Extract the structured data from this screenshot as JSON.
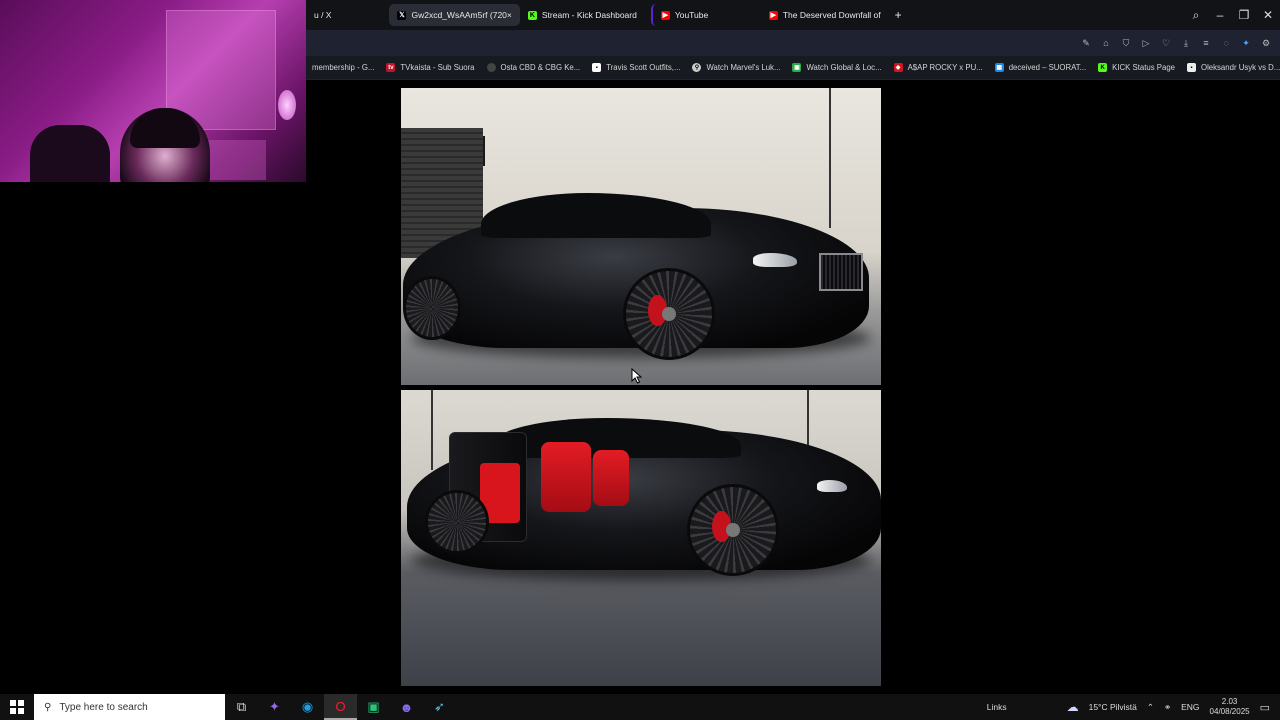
{
  "browser": {
    "tabs": [
      {
        "label": "u / X",
        "icon": "x-logo-icon",
        "active": false
      },
      {
        "label": "Gw2xcd_WsAAm5rf (720×",
        "icon": "x-logo-icon",
        "active": true
      },
      {
        "label": "Stream - Kick Dashboard",
        "icon": "kick-icon",
        "active": false
      },
      {
        "label": "YouTube",
        "icon": "youtube-icon",
        "active": false
      },
      {
        "label": "The Deserved Downfall of",
        "icon": "youtube-icon",
        "active": false
      }
    ],
    "new_tab_symbol": "+",
    "bookmarks": [
      {
        "label": "membership - G...",
        "color": "#888888"
      },
      {
        "label": "TVkaista - Sub Suora",
        "color": "#c0142c"
      },
      {
        "label": "Osta CBD & CBG Ke...",
        "color": "#666666"
      },
      {
        "label": "Travis Scott Outfits,...",
        "color": "#ffffff"
      },
      {
        "label": "Watch Marvel's Luk...",
        "color": "#dddddd"
      },
      {
        "label": "Watch Global & Loc...",
        "color": "#2aa84a"
      },
      {
        "label": "A$AP ROCKY x PU...",
        "color": "#d01420"
      },
      {
        "label": "deceived – SUORAT...",
        "color": "#1e88e5"
      },
      {
        "label": "KICK Status Page",
        "color": "#53fc18"
      },
      {
        "label": "Oleksandr Usyk vs D...",
        "color": "#eeeeee"
      }
    ]
  },
  "taskbar": {
    "search_placeholder": "Type here to search",
    "links_label": "Links",
    "weather": "15°C  Pilvistä",
    "language": "ENG",
    "time": "2.03",
    "date": "04/08/2025"
  },
  "colors": {
    "accent": "#4aa3ff",
    "kick": "#53fc18",
    "youtube": "#ff0000"
  }
}
